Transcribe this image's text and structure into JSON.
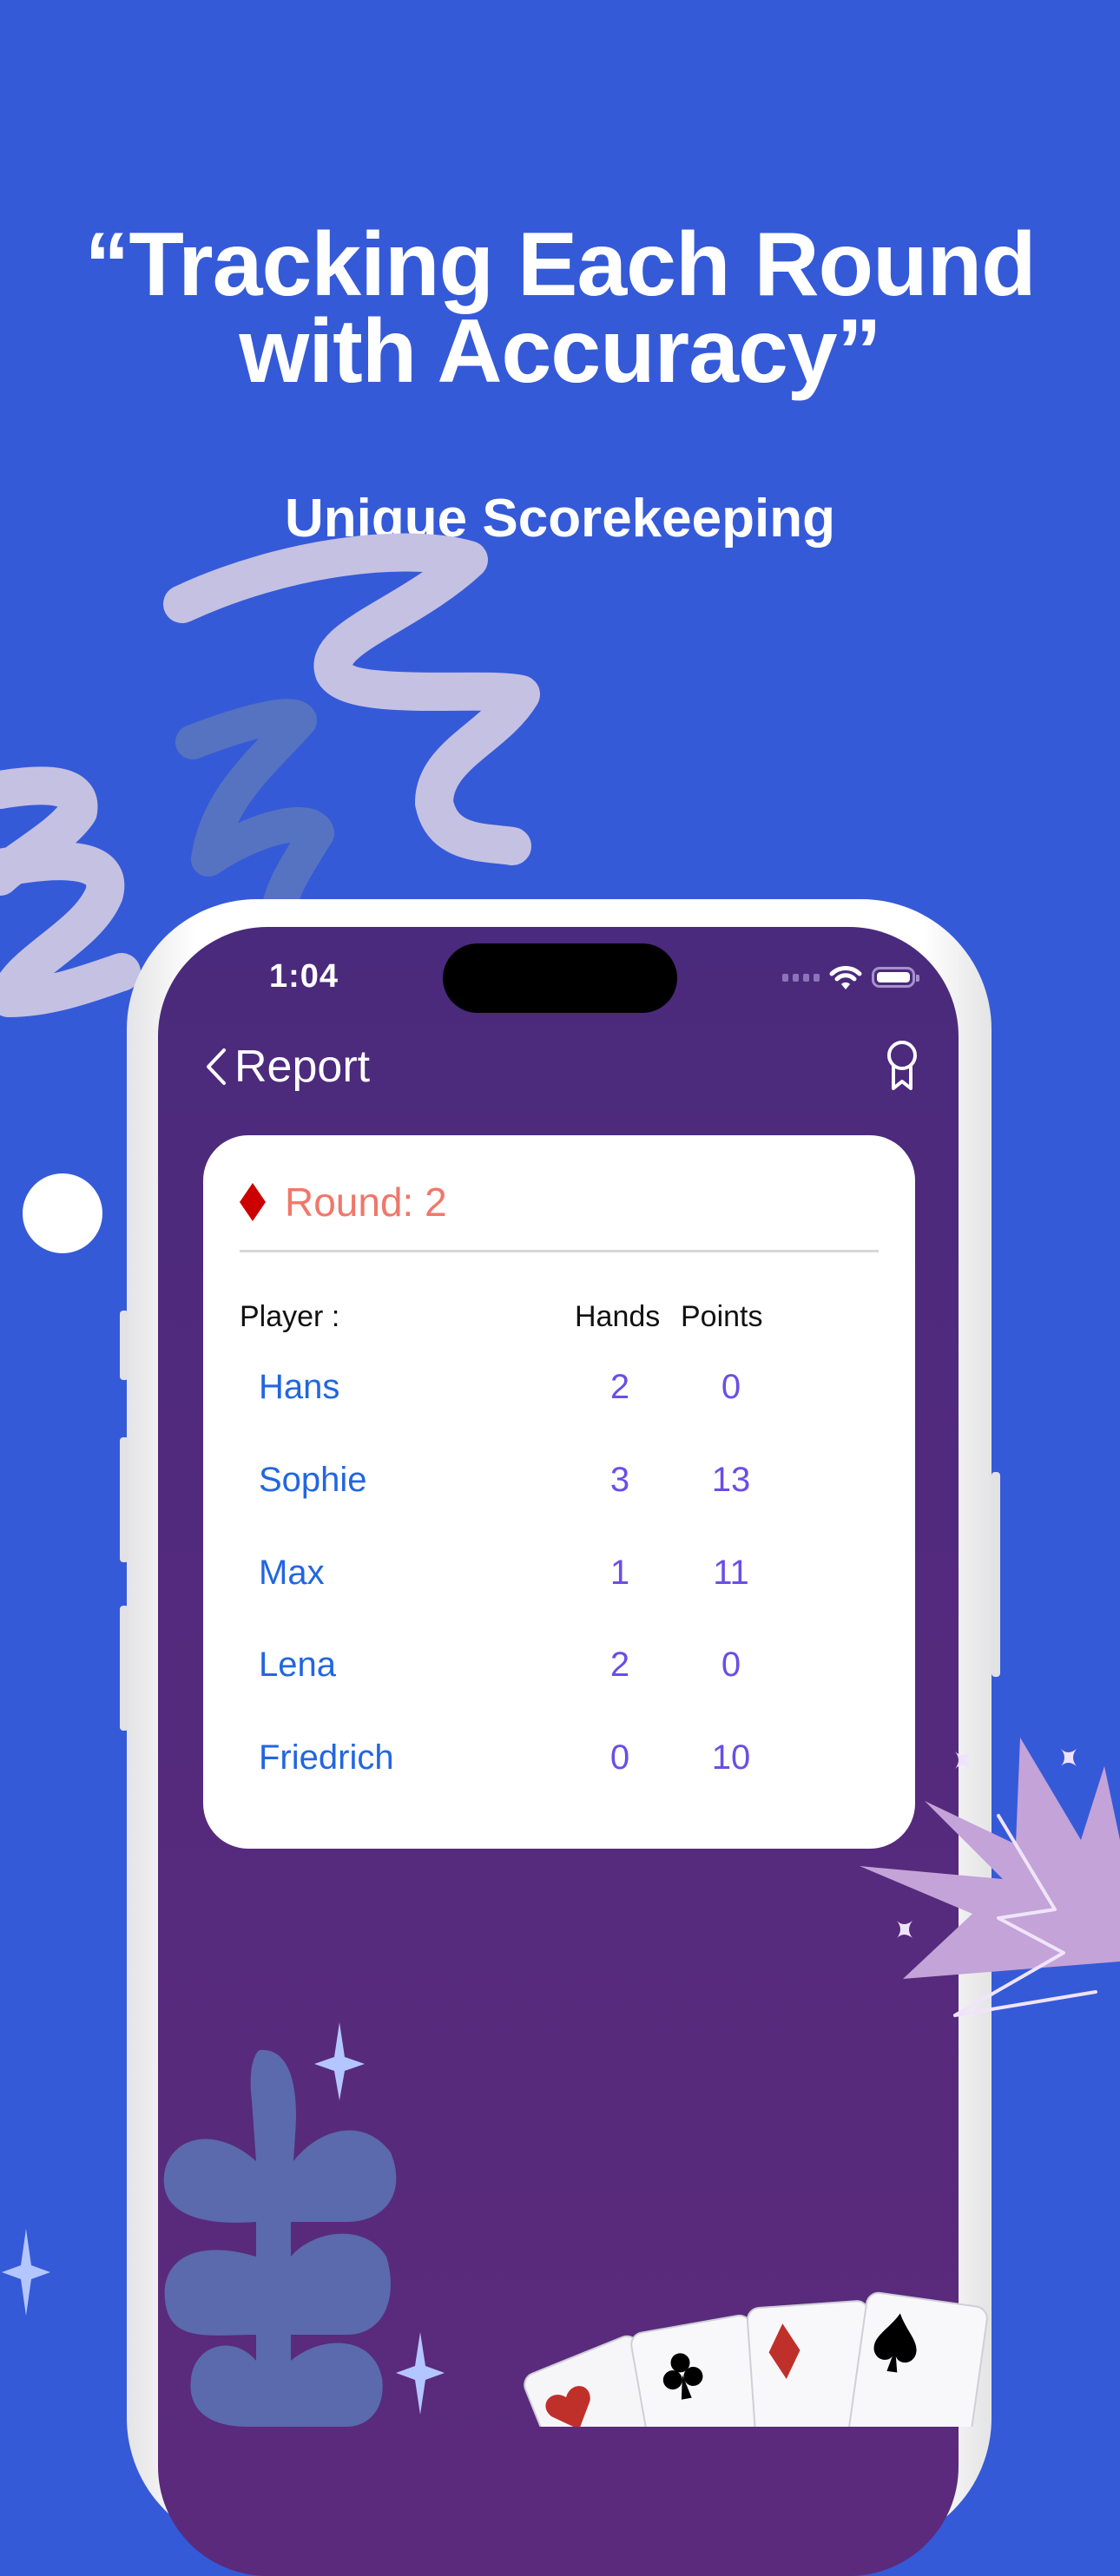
{
  "headline": {
    "line1": "“Tracking Each Round",
    "line2": "with Accuracy”",
    "subtitle": "Unique Scorekeeping"
  },
  "colors": {
    "background": "#355ad8",
    "screen": "#532a7d",
    "round_title": "#f0776a",
    "diamond": "#cc0000",
    "player_name": "#2266e0",
    "score_value": "#6a4ee6"
  },
  "status_bar": {
    "time": "1:04",
    "icons": [
      "cellular-signal-icon",
      "wifi-icon",
      "battery-icon"
    ]
  },
  "nav": {
    "back_icon": "chevron-left-icon",
    "title": "Report",
    "right_icon": "award-ribbon-icon"
  },
  "report": {
    "suit_icon": "diamond-suit-icon",
    "round_label": "Round: 2",
    "columns": {
      "player": "Player :",
      "hands": "Hands",
      "points": "Points"
    },
    "rows": [
      {
        "name": "Hans",
        "hands": "2",
        "points": "0"
      },
      {
        "name": "Sophie",
        "hands": "3",
        "points": "13"
      },
      {
        "name": "Max",
        "hands": "1",
        "points": "11"
      },
      {
        "name": "Lena",
        "hands": "2",
        "points": "0"
      },
      {
        "name": "Friedrich",
        "hands": "0",
        "points": "10"
      }
    ]
  },
  "decorations": {
    "cards": [
      "hearts",
      "clubs",
      "diamonds",
      "spades"
    ]
  }
}
